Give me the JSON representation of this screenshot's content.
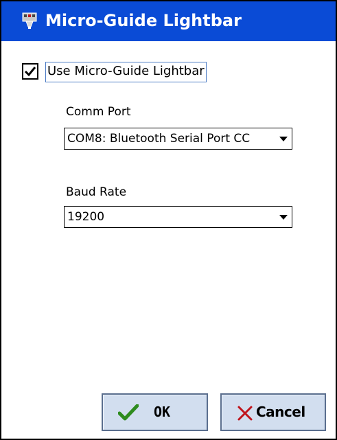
{
  "window": {
    "title": "Micro-Guide Lightbar",
    "title_bar_color": "#0a4bd6",
    "app_icon": "gps-receiver-icon"
  },
  "options": {
    "use_lightbar_label": "Use Micro-Guide Lightbar",
    "use_lightbar_checked": true
  },
  "comm_port": {
    "label": "Comm Port",
    "value": "COM8: Bluetooth Serial Port CC"
  },
  "baud_rate": {
    "label": "Baud Rate",
    "value": "19200"
  },
  "buttons": {
    "ok_label": "OK",
    "ok_icon": "checkmark-icon",
    "ok_icon_color": "#2e8b1e",
    "cancel_label": "Cancel",
    "cancel_icon": "x-mark-icon",
    "cancel_icon_color": "#c0141c"
  }
}
